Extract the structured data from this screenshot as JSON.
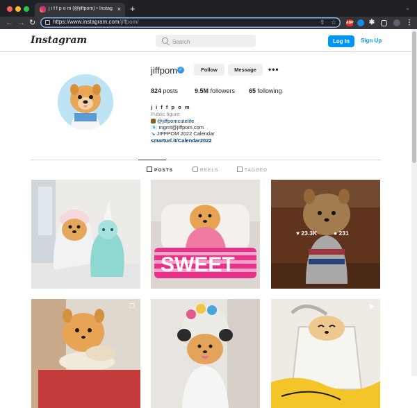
{
  "browser": {
    "tab_title": "j i f f p o m (@jiffpom) • Instagr...",
    "tab_close": "×",
    "new_tab": "+",
    "url_host": "https://www.instagram.com",
    "url_path": "/jiffpom/",
    "extensions": [
      "ABP",
      "camera-extension",
      "puzzle-extension",
      "sidepanel",
      "profile",
      "menu"
    ]
  },
  "header": {
    "logo": "Instagram",
    "search_placeholder": "Search",
    "login_label": "Log In",
    "signup_label": "Sign Up"
  },
  "profile": {
    "username": "jiffpom",
    "verified": true,
    "follow_label": "Follow",
    "message_label": "Message",
    "more_label": "•••",
    "posts_count": "824",
    "posts_label": "posts",
    "followers_count": "9.5M",
    "followers_label": "followers",
    "following_count": "65",
    "following_label": "following",
    "display_name": "j i f f p o m",
    "category": "Public figure",
    "bio_mention": "@jiffpomcutelife",
    "bio_email": "mgmt@jiffpom.com",
    "bio_line3": "JIFFPOM 2022 Calendar",
    "bio_link": "smarturl.it/Calendar2022",
    "email_prefix": "📧",
    "arrow_prefix": "↘"
  },
  "tabs": [
    {
      "label": "POSTS",
      "active": true
    },
    {
      "label": "REELS",
      "active": false
    },
    {
      "label": "TAGGED",
      "active": false
    }
  ],
  "posts": [
    {
      "id": 1,
      "hover": false
    },
    {
      "id": 2,
      "hover": false
    },
    {
      "id": 3,
      "hover": true,
      "likes": "23.3K",
      "comments": "231"
    },
    {
      "id": 4,
      "type_icon": "carousel"
    },
    {
      "id": 5,
      "type_icon": "none"
    },
    {
      "id": 6,
      "type_icon": "video"
    }
  ],
  "colors": {
    "accent": "#0095f6",
    "verified": "#3897f0",
    "text": "#262626",
    "muted": "#8e8e8e"
  }
}
